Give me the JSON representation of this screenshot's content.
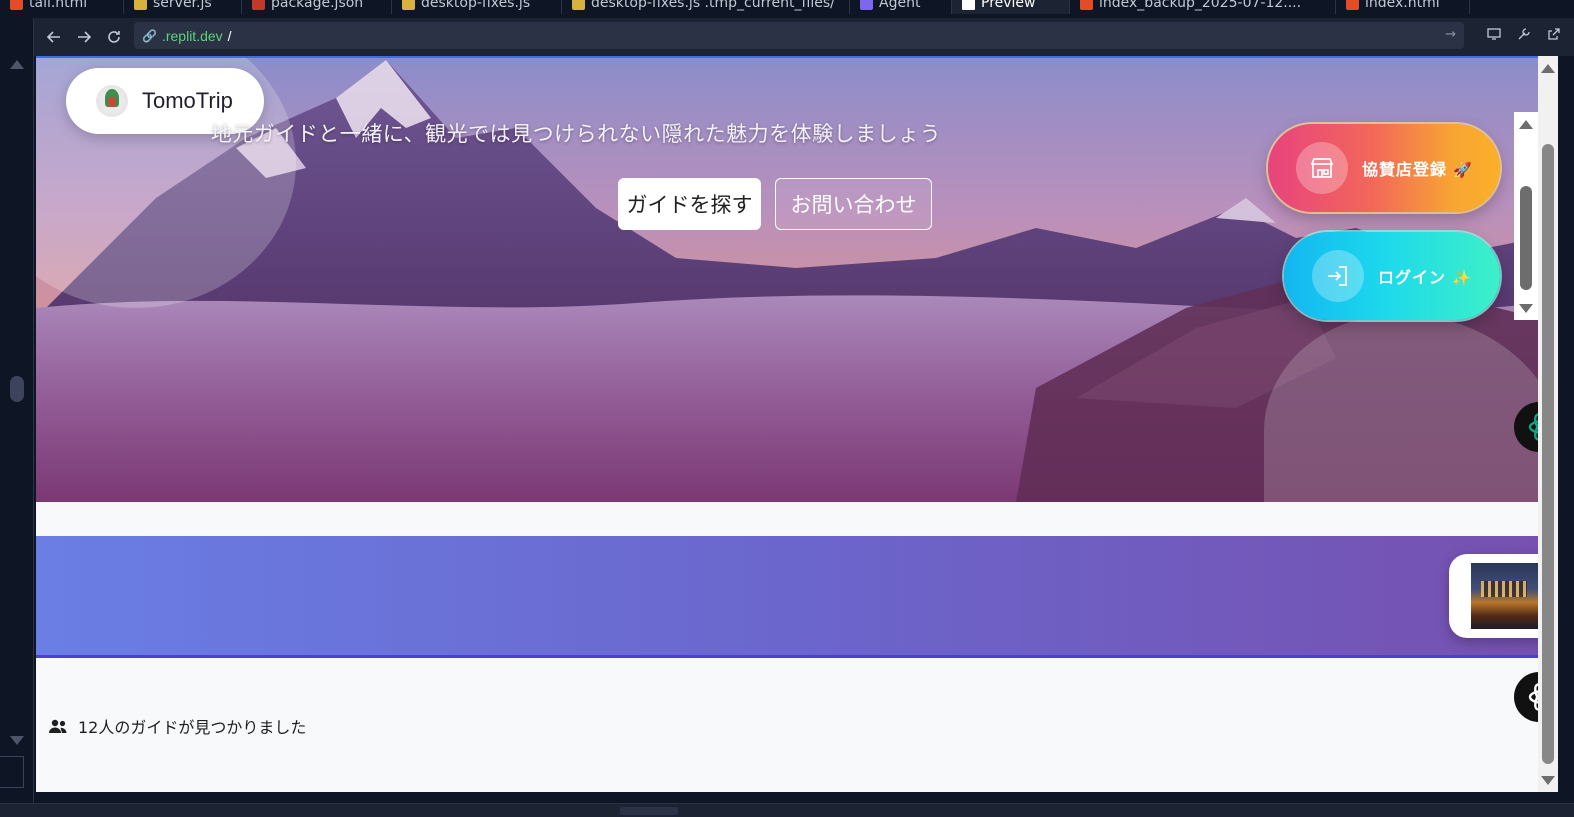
{
  "tabs": [
    {
      "label": "tall.html",
      "icon_color": "#e34c26"
    },
    {
      "label": "server.js",
      "icon_color": "#d7b23c"
    },
    {
      "label": "package.json",
      "icon_color": "#c0392b"
    },
    {
      "label": "desktop-fixes.js",
      "icon_color": "#d7b23c"
    },
    {
      "label": "desktop-fixes.js .tmp_current_files/",
      "icon_color": "#d7b23c"
    },
    {
      "label": "Agent",
      "icon_color": "#7b68ee"
    },
    {
      "label": "Preview",
      "icon_color": "#ffffff"
    },
    {
      "label": "index_backup_2025-07-12....",
      "icon_color": "#e34c26"
    },
    {
      "label": "index.html",
      "icon_color": "#e34c26"
    }
  ],
  "urlbar": {
    "url_host": ".replit.dev",
    "url_path": "/"
  },
  "site": {
    "brand": "TomoTrip",
    "hero_subtitle": "地元ガイドと一緒に、観光では見つけられない隠れた魅力を体験しましょう",
    "find_guide_button": "ガイドを探す",
    "contact_button": "お問い合わせ",
    "sponsor_button": "協賛店登録",
    "sponsor_emoji": "🚀",
    "login_button": "ログイン",
    "login_emoji": "✨",
    "results_text": "12人のガイドが見つかりました"
  },
  "colors": {
    "accent_blue": "#3b6df0",
    "url_green": "#5bd37a",
    "sponsor_gradient_start": "#e8437e",
    "sponsor_gradient_end": "#fbb028",
    "login_gradient_start": "#13b6f0",
    "login_gradient_end": "#3ef0c8",
    "band_start": "#6a7ee4",
    "band_end": "#7651b0"
  },
  "icons": {
    "back": "arrow-left-icon",
    "forward": "arrow-right-icon",
    "reload": "reload-icon",
    "link": "link-icon",
    "devices": "monitor-icon",
    "tools": "wrench-icon",
    "open_external": "external-link-icon",
    "store": "store-icon",
    "login": "sign-in-icon",
    "users": "users-icon",
    "chatgpt": "openai-icon"
  }
}
